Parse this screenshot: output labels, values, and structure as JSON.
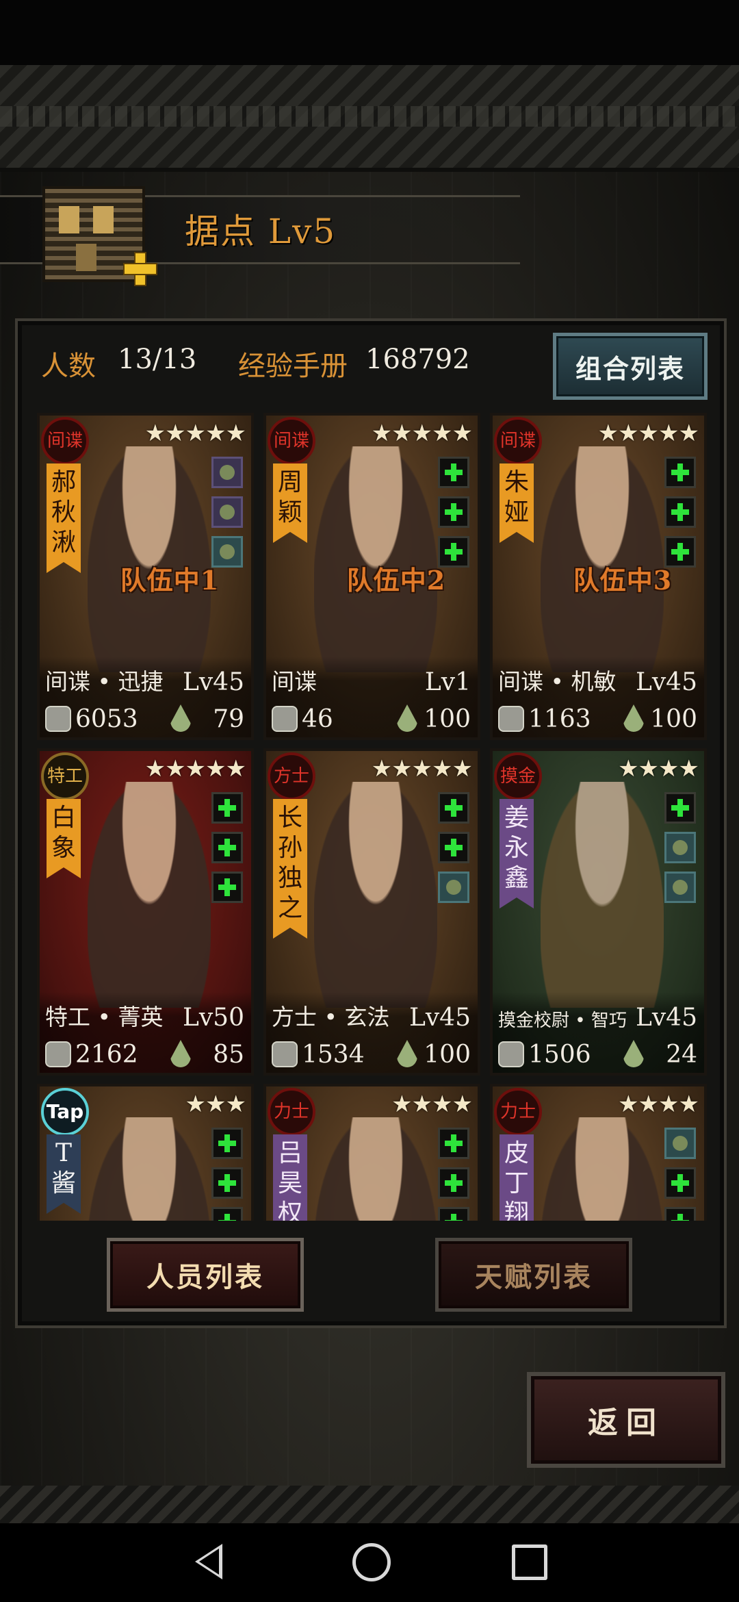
{
  "header": {
    "title": "据点  Lv5"
  },
  "stats": {
    "members_label": "人数",
    "members_value": "13/13",
    "manual_label": "经验手册",
    "manual_value": "168792",
    "combo_button": "组合列表"
  },
  "cards": [
    {
      "badge": "间谍",
      "stars": "★★★★★",
      "name": "郝秋湫",
      "team": "队伍中1",
      "job": "间谍 • 迅捷",
      "level": "Lv45",
      "power": "6053",
      "stamina": "79"
    },
    {
      "badge": "间谍",
      "stars": "★★★★★",
      "name": "周颖",
      "team": "队伍中2",
      "job": "间谍",
      "level": "Lv1",
      "power": "46",
      "stamina": "100"
    },
    {
      "badge": "间谍",
      "stars": "★★★★★",
      "name": "朱娅",
      "team": "队伍中3",
      "job": "间谍 • 机敏",
      "level": "Lv45",
      "power": "1163",
      "stamina": "100"
    },
    {
      "badge": "特工",
      "stars": "★★★★★",
      "name": "白象",
      "team": "",
      "job": "特工 • 菁英",
      "level": "Lv50",
      "power": "2162",
      "stamina": "85"
    },
    {
      "badge": "方士",
      "stars": "★★★★★",
      "name": "长孙独之",
      "team": "",
      "job": "方士 • 玄法",
      "level": "Lv45",
      "power": "1534",
      "stamina": "100"
    },
    {
      "badge": "摸金",
      "stars": "★★★★",
      "name": "姜永鑫",
      "team": "",
      "job": "摸金校尉 • 智巧",
      "level": "Lv45",
      "power": "1506",
      "stamina": "24"
    },
    {
      "badge": "Tap",
      "stars": "★★★",
      "name": "T酱",
      "team": "",
      "job": "",
      "level": "",
      "power": "",
      "stamina": ""
    },
    {
      "badge": "力士",
      "stars": "★★★★",
      "name": "吕昊权",
      "team": "",
      "job": "",
      "level": "",
      "power": "",
      "stamina": ""
    },
    {
      "badge": "力士",
      "stars": "★★★★",
      "name": "皮丁翔",
      "team": "",
      "job": "",
      "level": "",
      "power": "",
      "stamina": ""
    }
  ],
  "tabs": {
    "personnel": "人员列表",
    "talent": "天赋列表"
  },
  "back_button": "返回",
  "icons": {
    "power": "fist-icon",
    "stamina": "drop-icon",
    "empty_slot": "plus-icon"
  },
  "colors": {
    "accent_orange": "#e09a3a",
    "badge_red": "#e0342a",
    "slot_green": "#2ee33b"
  }
}
